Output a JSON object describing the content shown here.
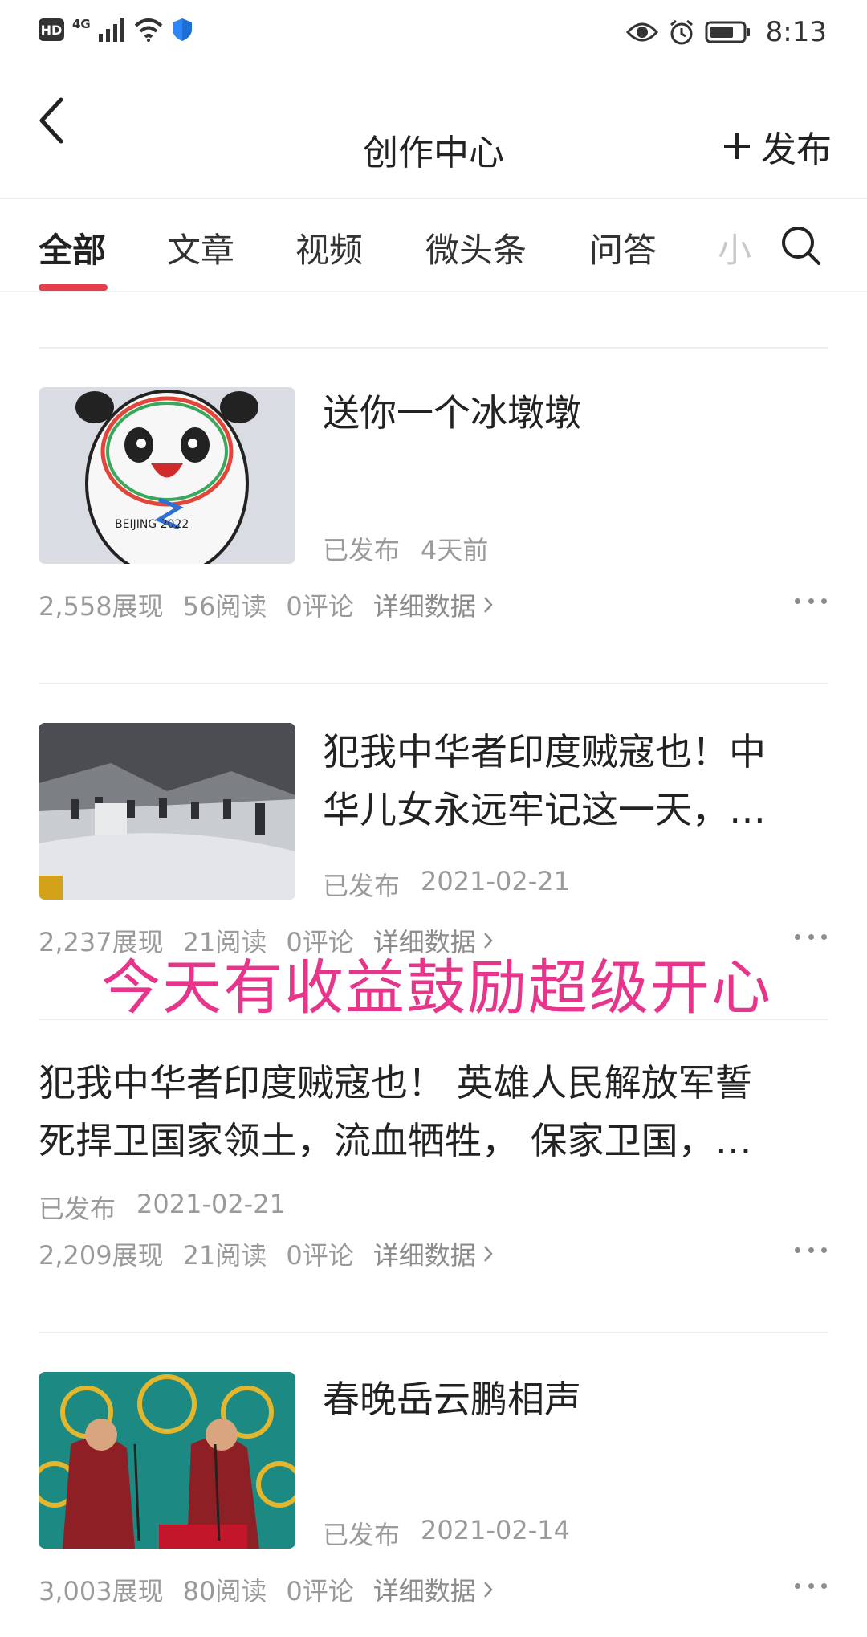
{
  "status_bar": {
    "hd_badge": "HD",
    "network": "4G",
    "time": "8:13",
    "icons": [
      "signal-icon",
      "wifi-icon",
      "shield-icon",
      "eye-icon",
      "alarm-icon",
      "battery-icon"
    ]
  },
  "header": {
    "title": "创作中心",
    "publish_label": "发布"
  },
  "tabs": {
    "items": [
      "全部",
      "文章",
      "视频",
      "微头条",
      "问答",
      "小"
    ],
    "active_index": 0
  },
  "colors": {
    "accent": "#e5404a",
    "overlay_text": "#e6358a",
    "meta_text": "#9a9a9a"
  },
  "items": [
    {
      "title_line1": "送你一个冰墩墩",
      "status": "已发布",
      "time": "4天前",
      "impressions": "2,558展现",
      "reads": "56阅读",
      "comments": "0评论",
      "detail": "详细数据",
      "thumbnail": "bing-dwen-dwen-drawing"
    },
    {
      "title_line1": "犯我中华者印度贼寇也！中",
      "title_line2": "华儿女永远牢记这一天，…",
      "status": "已发布",
      "time": "2021-02-21",
      "impressions": "2,237展现",
      "reads": "21阅读",
      "comments": "0评论",
      "detail": "详细数据",
      "thumbnail": "soldiers-river-scene"
    },
    {
      "title_line1": "犯我中华者印度贼寇也！ 英雄人民解放军誓",
      "title_line2": "死捍卫国家领土，流血牺牲， 保家卫国，…",
      "status": "已发布",
      "time": "2021-02-21",
      "impressions": "2,209展现",
      "reads": "21阅读",
      "comments": "0评论",
      "detail": "详细数据"
    },
    {
      "title_line1": "春晚岳云鹏相声",
      "status": "已发布",
      "time": "2021-02-14",
      "impressions": "3,003展现",
      "reads": "80阅读",
      "comments": "0评论",
      "detail": "详细数据",
      "thumbnail": "crosstalk-performers-stage"
    }
  ],
  "overlay_caption": "今天有收益鼓励超级开心"
}
